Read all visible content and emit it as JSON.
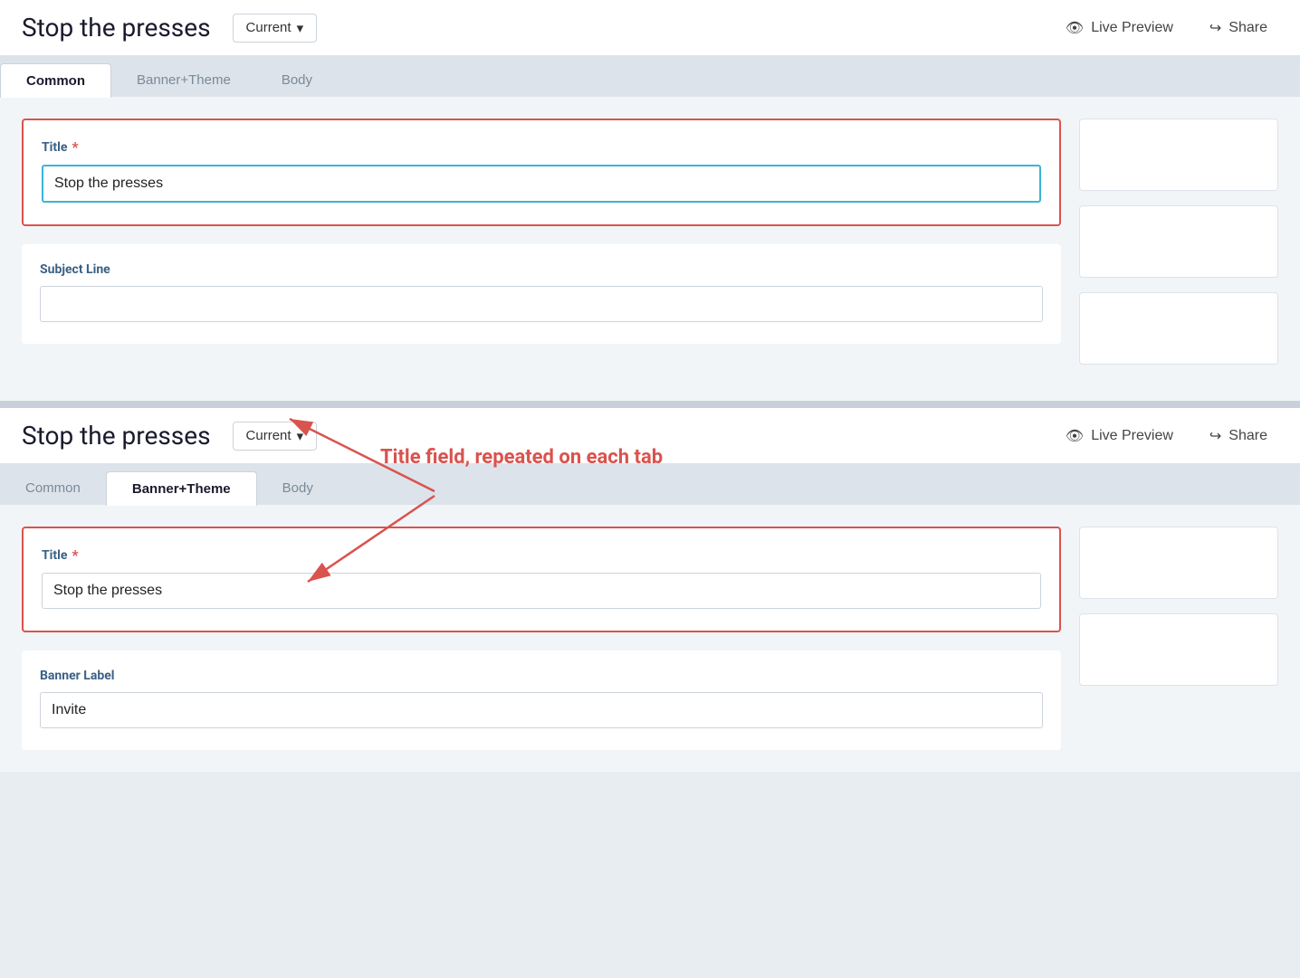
{
  "page": {
    "title": "Stop the presses",
    "version_label": "Current",
    "chevron": "▾",
    "live_preview_label": "Live Preview",
    "share_label": "Share"
  },
  "tabs_top": {
    "items": [
      {
        "id": "common",
        "label": "Common",
        "active": true
      },
      {
        "id": "banner_theme",
        "label": "Banner+Theme",
        "active": false
      },
      {
        "id": "body",
        "label": "Body",
        "active": false
      }
    ]
  },
  "tabs_bottom": {
    "items": [
      {
        "id": "common",
        "label": "Common",
        "active": false
      },
      {
        "id": "banner_theme",
        "label": "Banner+Theme",
        "active": true
      },
      {
        "id": "body",
        "label": "Body",
        "active": false
      }
    ]
  },
  "form_top": {
    "title_label": "Title",
    "title_required": "*",
    "title_value": "Stop the presses",
    "subject_line_label": "Subject Line",
    "subject_line_value": ""
  },
  "form_bottom": {
    "title_label": "Title",
    "title_required": "*",
    "title_value": "Stop the presses",
    "banner_label_label": "Banner Label",
    "banner_label_value": "Invite"
  },
  "annotation": {
    "text": "Title field, repeated on each tab"
  },
  "icons": {
    "eye": "👁",
    "share": "↪"
  }
}
